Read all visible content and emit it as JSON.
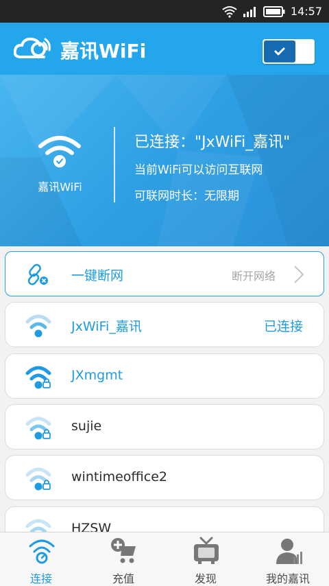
{
  "status_bar": {
    "time": "14:57"
  },
  "app": {
    "title": "嘉讯WiFi"
  },
  "hero": {
    "ssid_label": "嘉讯WiFi",
    "connected_text": "已连接：\"JxWiFi_嘉讯\"",
    "access_text": "当前WiFi可以访问互联网",
    "duration_text": "可联网时长：无限期"
  },
  "disconnect": {
    "label": "一键断网",
    "sub_label": "断开网络"
  },
  "networks": [
    {
      "name": "JxWiFi_嘉讯",
      "status": "已连接"
    },
    {
      "name": "JXmgmt",
      "status": ""
    },
    {
      "name": "sujie",
      "status": ""
    },
    {
      "name": "wintimeoffice2",
      "status": ""
    },
    {
      "name": "HZSW",
      "status": ""
    }
  ],
  "tabs": [
    {
      "label": "连接",
      "icon": "connect-wifi-icon"
    },
    {
      "label": "充值",
      "icon": "recharge-cart-icon"
    },
    {
      "label": "发现",
      "icon": "discover-tv-icon"
    },
    {
      "label": "我的嘉讯",
      "icon": "my-account-icon"
    }
  ],
  "colors": {
    "primary": "#24a6ec",
    "accent_text": "#1e9be1",
    "dark_toggle": "#176bb0"
  }
}
